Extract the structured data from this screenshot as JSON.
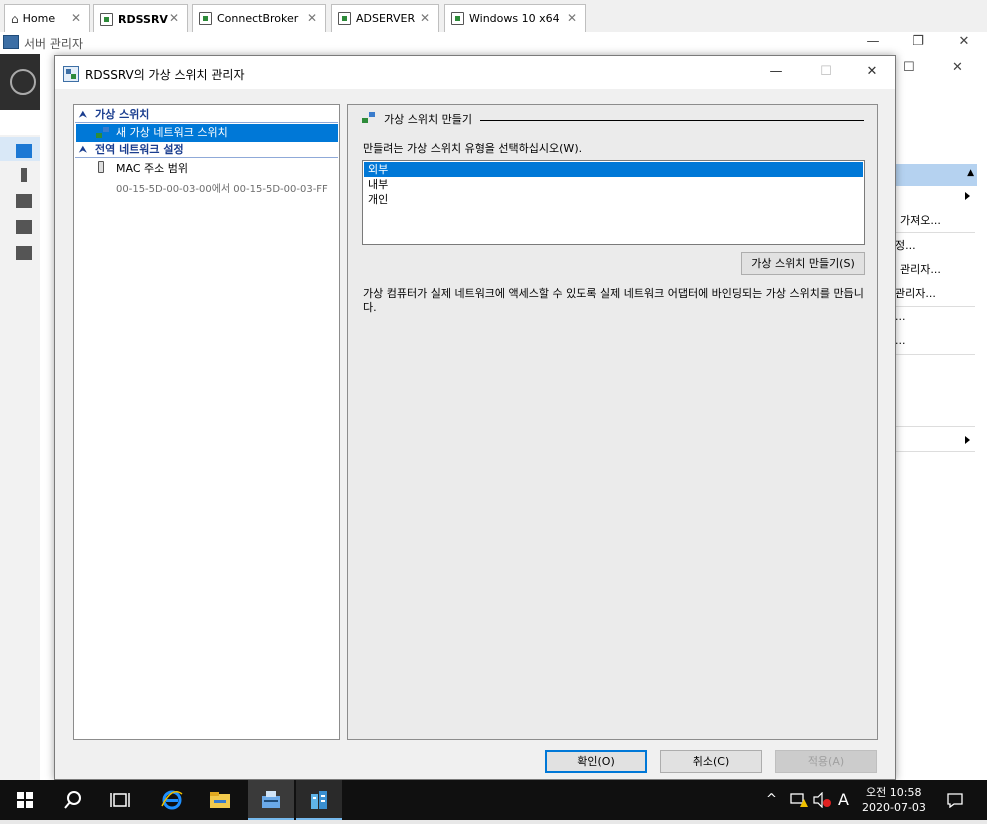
{
  "host_tabs": [
    {
      "label": "Home",
      "icon": "home-icon"
    },
    {
      "label": "RDSSRV",
      "icon": "vm-icon"
    },
    {
      "label": "ConnectBroker",
      "icon": "vm-icon"
    },
    {
      "label": "ADSERVER",
      "icon": "vm-icon"
    },
    {
      "label": "Windows 10 x64",
      "icon": "vm-icon"
    }
  ],
  "server_manager": {
    "title": "서버 관리자",
    "right_items": [
      "가져오...",
      "정...",
      "관리자...",
      "관리자...",
      "...",
      "..."
    ]
  },
  "dialog": {
    "title": "RDSSRV의 가상 스위치 관리자",
    "tree": {
      "section1": "가상 스위치",
      "new_switch": "새 가상 네트워크 스위치",
      "section2": "전역 네트워크 설정",
      "mac_range": "MAC 주소 범위",
      "mac_range_value": "00-15-5D-00-03-00에서 00-15-5D-00-03-FF"
    },
    "panel": {
      "header": "가상 스위치 만들기",
      "prompt": "만들려는 가상 스위치 유형을 선택하십시오(W).",
      "switch_types": [
        "외부",
        "내부",
        "개인"
      ],
      "selected_type": "외부",
      "create_button": "가상 스위치 만들기(S)",
      "description": "가상 컴퓨터가 실제 네트워크에 액세스할 수 있도록 실제 네트워크 어댑터에 바인딩되는 가상 스위치를 만듭니다."
    },
    "buttons": {
      "ok": "확인(O)",
      "cancel": "취소(C)",
      "apply": "적용(A)"
    }
  },
  "taskbar": {
    "time": "오전 10:58",
    "date": "2020-07-03",
    "input_indicator": "A"
  }
}
